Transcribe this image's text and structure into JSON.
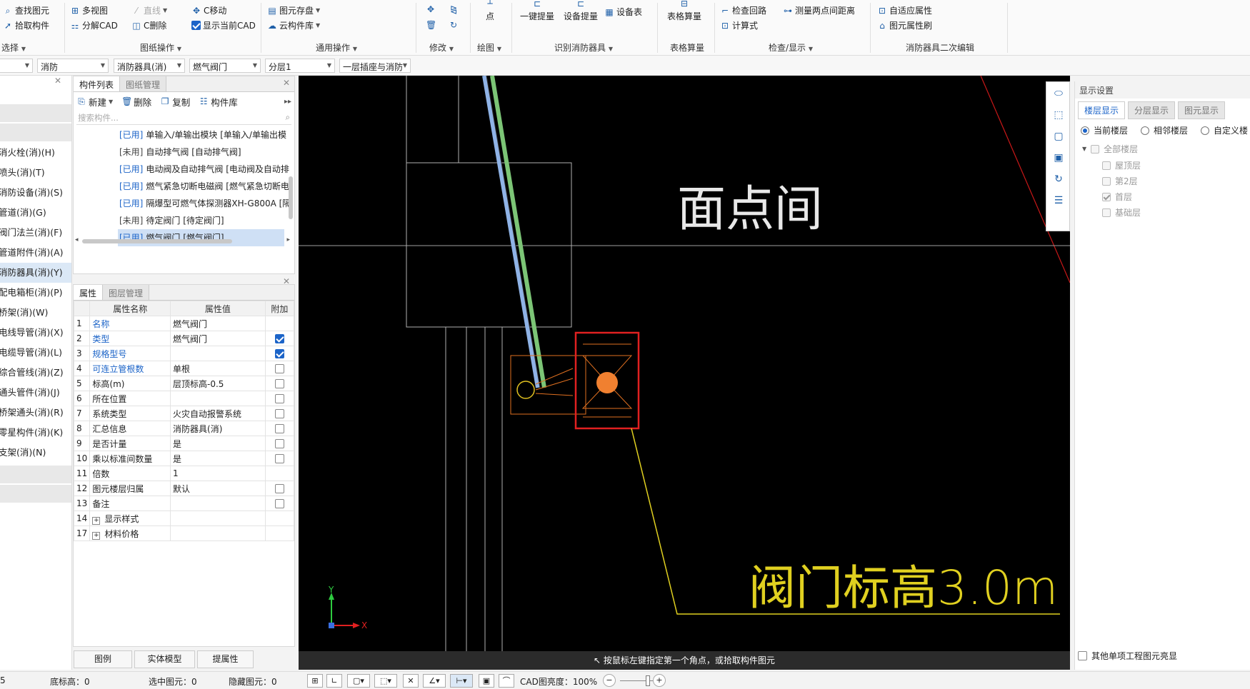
{
  "ribbon": {
    "select_group": {
      "find_element": "查找图元",
      "pick_component": "拾取构件",
      "label": "选择"
    },
    "drawing_ops": {
      "multi_view": "多视图",
      "explode_cad": "分解CAD",
      "straight_line": "直线",
      "c_delete": "C删除",
      "c_move": "C移动",
      "show_current_cad": "显示当前CAD",
      "label": "图纸操作"
    },
    "general_ops": {
      "element_save": "图元存盘",
      "cloud_library": "云构件库",
      "label": "通用操作"
    },
    "modify": {
      "label": "修改"
    },
    "draw": {
      "point": "点",
      "label": "绘图"
    },
    "recognize": {
      "one_click": "一键提量",
      "device_extract": "设备提量",
      "device_table": "设备表",
      "label": "识别消防器具"
    },
    "table_calc": {
      "table_calc": "表格算量",
      "label": "表格算量"
    },
    "check_display": {
      "check_loop": "检查回路",
      "measure_dist": "测量两点间距离",
      "formula": "计算式",
      "label": "检查/显示"
    },
    "secondary_edit": {
      "adaptive_attr": "自适应属性",
      "attr_brush": "图元属性刷",
      "label": "消防器具二次编辑"
    }
  },
  "filterbar": {
    "floor": "",
    "discipline": "消防",
    "type": "消防器具(消)",
    "component": "燃气阀门",
    "layer": "分层1",
    "placement": "一层插座与消防"
  },
  "leftpanel": {
    "items": [
      "消火栓(消)(H)",
      "喷头(消)(T)",
      "消防设备(消)(S)",
      "管道(消)(G)",
      "阀门法兰(消)(F)",
      "管道附件(消)(A)",
      "消防器具(消)(Y)",
      "配电箱柜(消)(P)",
      "桥架(消)(W)",
      "电线导管(消)(X)",
      "电缆导管(消)(L)",
      "综合管线(消)(Z)",
      "通头管件(消)(J)",
      "桥架通头(消)(R)",
      "零星构件(消)(K)",
      "支架(消)(N)"
    ],
    "selected_index": 6
  },
  "comppanel": {
    "tabs": [
      "构件列表",
      "图纸管理"
    ],
    "toolbar": {
      "new": "新建",
      "delete": "删除",
      "copy": "复制",
      "library": "构件库"
    },
    "search_placeholder": "搜索构件...",
    "items": [
      {
        "status": "[已用]",
        "text": "单输入/单输出模块 [单输入/单输出模"
      },
      {
        "status": "[未用]",
        "text": "自动排气阀 [自动排气阀]"
      },
      {
        "status": "[已用]",
        "text": "电动阀及自动排气阀 [电动阀及自动排"
      },
      {
        "status": "[已用]",
        "text": "燃气紧急切断电磁阀 [燃气紧急切断电"
      },
      {
        "status": "[已用]",
        "text": "隔爆型可燃气体探测器XH-G800A [隔"
      },
      {
        "status": "[未用]",
        "text": "待定阀门 [待定阀门]"
      },
      {
        "status": "[已用]",
        "text": "燃气阀门 [燃气阀门]"
      }
    ]
  },
  "proppanel": {
    "tabs": [
      "属性",
      "图层管理"
    ],
    "headers": [
      "",
      "属性名称",
      "属性值",
      "附加"
    ],
    "rows": [
      {
        "n": "1",
        "name": "名称",
        "value": "燃气阀门",
        "blue": true,
        "cb": null
      },
      {
        "n": "2",
        "name": "类型",
        "value": "燃气阀门",
        "blue": true,
        "cb": true
      },
      {
        "n": "3",
        "name": "规格型号",
        "value": "",
        "blue": true,
        "cb": true
      },
      {
        "n": "4",
        "name": "可连立管根数",
        "value": "单根",
        "blue": true,
        "cb": false
      },
      {
        "n": "5",
        "name": "标高(m)",
        "value": "层顶标高-0.5",
        "blue": false,
        "cb": false
      },
      {
        "n": "6",
        "name": "所在位置",
        "value": "",
        "blue": false,
        "cb": false
      },
      {
        "n": "7",
        "name": "系统类型",
        "value": "火灾自动报警系统",
        "blue": false,
        "cb": false
      },
      {
        "n": "8",
        "name": "汇总信息",
        "value": "消防器具(消)",
        "blue": false,
        "cb": false
      },
      {
        "n": "9",
        "name": "是否计量",
        "value": "是",
        "blue": false,
        "cb": false
      },
      {
        "n": "10",
        "name": "乘以标准间数量",
        "value": "是",
        "blue": false,
        "cb": false
      },
      {
        "n": "11",
        "name": "倍数",
        "value": "1",
        "blue": false,
        "cb": null
      },
      {
        "n": "12",
        "name": "图元楼层归属",
        "value": "默认",
        "blue": false,
        "cb": false
      },
      {
        "n": "13",
        "name": "备注",
        "value": "",
        "blue": false,
        "cb": false
      },
      {
        "n": "14",
        "name": "显示样式",
        "value": "",
        "blue": false,
        "cb": null,
        "expand": true
      },
      {
        "n": "17",
        "name": "材料价格",
        "value": "",
        "blue": false,
        "cb": null,
        "expand": true
      }
    ]
  },
  "bottom_buttons": {
    "legend": "图例",
    "solid_model": "实体模型",
    "extract_attr": "提属性"
  },
  "canvas": {
    "text_upper": "面点间",
    "text_lower": "阀门标高3.0m",
    "axis_x": "X",
    "axis_y": "Y",
    "status_message": "按鼠标左键指定第一个角点，或拾取构件图元",
    "colors": {
      "background": "#000000",
      "pipe_blue": "#8fb3e6",
      "pipe_green": "#7cc576",
      "highlight": "#e02020",
      "valve": "#f08030",
      "annotation": "#e0d020"
    }
  },
  "rightpanel": {
    "title": "显示设置",
    "tabs": [
      "楼层显示",
      "分层显示",
      "图元显示"
    ],
    "radios": [
      "当前楼层",
      "相邻楼层",
      "自定义楼"
    ],
    "tree_root": "全部楼层",
    "floors": [
      {
        "name": "屋顶层",
        "checked": false
      },
      {
        "name": "第2层",
        "checked": false
      },
      {
        "name": "首层",
        "checked": true
      },
      {
        "name": "基础层",
        "checked": false
      }
    ],
    "bottom_check": "其他单项工程图元亮显"
  },
  "statusbar": {
    "floor_height_partial": "5",
    "base_elevation": "底标高：0",
    "selected_elements": "选中图元：0",
    "hidden_elements": "隐藏图元：0",
    "cad_brightness": "CAD图亮度：100%"
  }
}
